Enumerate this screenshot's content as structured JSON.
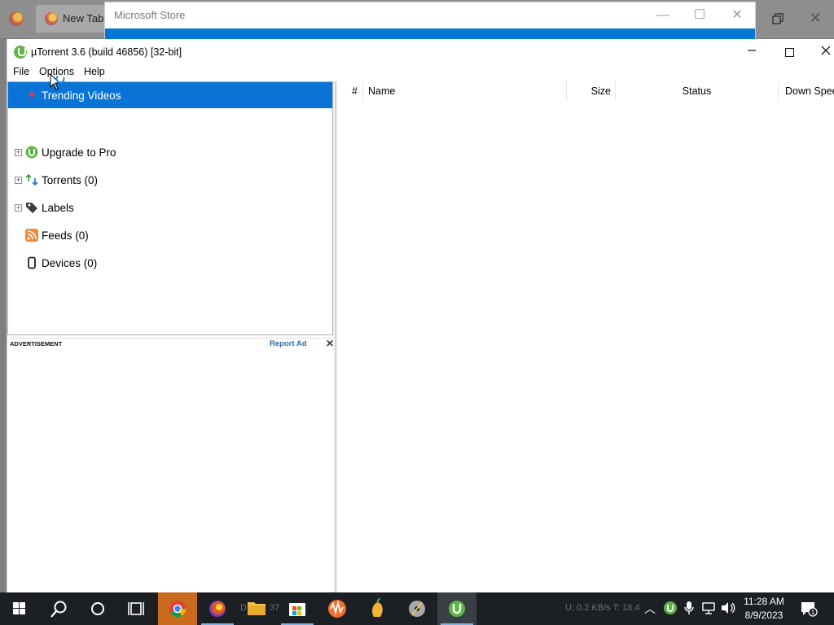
{
  "browser": {
    "tab_label": "New Tab"
  },
  "store_window": {
    "title": "Microsoft Store"
  },
  "utorrent": {
    "title": "µTorrent 3.6  (build 46856) [32-bit]",
    "menu": {
      "file": "File",
      "options": "Options",
      "help": "Help"
    },
    "sidebar": {
      "items": [
        {
          "label": "Trending Videos",
          "icon": "trending-icon",
          "selected": true
        },
        {
          "label": "Upgrade to Pro",
          "icon": "utorrent-logo-icon",
          "expandable": true
        },
        {
          "label": "Torrents (0)",
          "icon": "torrents-icon",
          "expandable": true
        },
        {
          "label": "Labels",
          "icon": "tag-icon",
          "expandable": true
        },
        {
          "label": "Feeds (0)",
          "icon": "rss-icon"
        },
        {
          "label": "Devices (0)",
          "icon": "device-icon"
        }
      ]
    },
    "ad": {
      "label": "ADVERTISEMENT",
      "report": "Report Ad",
      "close": "✕"
    },
    "columns": {
      "num": "#",
      "name": "Name",
      "size": "Size",
      "status": "Status",
      "down_speed": "Down Speed"
    }
  },
  "taskbar": {
    "clock_time": "11:28 AM",
    "clock_date": "8/9/2023",
    "ghost_text_1": "D",
    "ghost_text_2": "37",
    "ghost_text_3": "U: 0.2 KB/s T: 18.4",
    "accent": "#0a74d6"
  }
}
